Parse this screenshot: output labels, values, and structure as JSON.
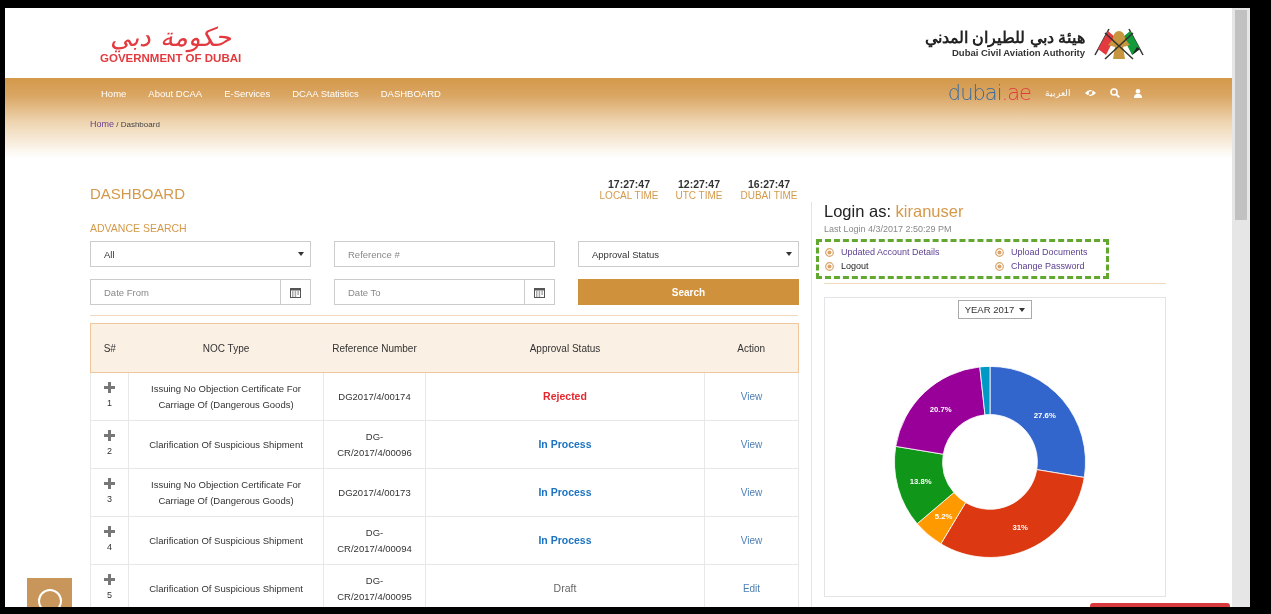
{
  "header": {
    "government_logo": {
      "arabic": "حكومة دبي",
      "english": "GOVERNMENT OF DUBAI"
    },
    "authority_logo": {
      "arabic": "هيئة دبي للطيران المدني",
      "english": "Dubai Civil Aviation Authority"
    }
  },
  "nav": {
    "items": [
      "Home",
      "About DCAA",
      "E-Services",
      "DCAA Statistics",
      "DASHBOARD"
    ],
    "portal_logo": {
      "name": "dubai",
      "suffix": ".ae"
    },
    "language": "العربية"
  },
  "breadcrumb": {
    "items": [
      "Home",
      "Dashboard"
    ],
    "separator": "/"
  },
  "dashboard": {
    "title": "DASHBOARD",
    "clocks": [
      {
        "time": "17:27:47",
        "label": "LOCAL TIME"
      },
      {
        "time": "12:27:47",
        "label": "UTC TIME"
      },
      {
        "time": "16:27:47",
        "label": "DUBAI TIME"
      }
    ],
    "advance_search": {
      "title": "ADVANCE SEARCH",
      "noc_type": {
        "value": "All"
      },
      "reference": {
        "placeholder": "Reference #"
      },
      "approval_status": {
        "value": "Approval Status"
      },
      "date_from": {
        "placeholder": "Date From"
      },
      "date_to": {
        "placeholder": "Date To"
      },
      "button": "Search"
    },
    "table": {
      "columns": [
        "S#",
        "NOC Type",
        "Reference Number",
        "Approval Status",
        "Action"
      ],
      "rows": [
        {
          "number": "1",
          "noc_type": "Issuing No Objection Certificate For Carriage Of (Dangerous Goods)",
          "reference": "DG2017/4/00174",
          "status": {
            "text": "Rejected",
            "kind": "rejected"
          },
          "action": "View"
        },
        {
          "number": "2",
          "noc_type": "Clarification Of Suspicious Shipment",
          "reference": "DG-CR/2017/4/00096",
          "status": {
            "text": "In Process",
            "kind": "in_process"
          },
          "action": "View"
        },
        {
          "number": "3",
          "noc_type": "Issuing No Objection Certificate For Carriage Of (Dangerous Goods)",
          "reference": "DG2017/4/00173",
          "status": {
            "text": "In Process",
            "kind": "in_process"
          },
          "action": "View"
        },
        {
          "number": "4",
          "noc_type": "Clarification Of Suspicious Shipment",
          "reference": "DG-CR/2017/4/00094",
          "status": {
            "text": "In Process",
            "kind": "in_process"
          },
          "action": "View"
        },
        {
          "number": "5",
          "noc_type": "Clarification Of Suspicious Shipment",
          "reference": "DG-CR/2017/4/00095",
          "status": {
            "text": "Draft",
            "kind": "draft"
          },
          "action": "Edit"
        }
      ]
    }
  },
  "account": {
    "login_label": "Login as:",
    "username": "kiranuser",
    "last_login": "Last Login 4/3/2017 2:50:29 PM",
    "links": [
      {
        "label": "Updated Account Details",
        "hovered": false
      },
      {
        "label": "Upload Documents",
        "hovered": false
      },
      {
        "label": "Logout",
        "hovered": true
      },
      {
        "label": "Change Password",
        "hovered": false
      }
    ]
  },
  "chart_panel": {
    "year": "YEAR 2017",
    "chart_data": {
      "type": "donut",
      "values": [
        27.6,
        31,
        5.2,
        13.8,
        20.7,
        1.7
      ],
      "value_labels": [
        "27.6%",
        "31%",
        "5.2%",
        "13.8%",
        "20.7%",
        null
      ],
      "colors": [
        "#3366cc",
        "#dc3912",
        "#ff9900",
        "#109618",
        "#990099",
        "#0099c6"
      ]
    }
  }
}
